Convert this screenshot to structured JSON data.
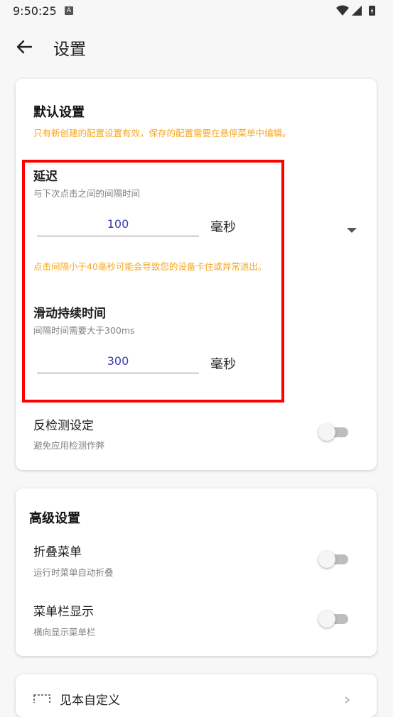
{
  "status_bar": {
    "time": "9:50:25",
    "notification_icon": "A"
  },
  "app_bar": {
    "title": "设置"
  },
  "default_settings": {
    "title": "默认设置",
    "notice": "只有新创建的配置设置有效，保存的配置需要在悬停菜单中编辑。",
    "delay": {
      "title": "延迟",
      "subtitle": "与下次点击之间的间隔时间",
      "value": "100",
      "unit": "毫秒",
      "warning": "点击间隔小于40毫秒可能会导致您的设备卡住或异常退出。"
    },
    "swipe_duration": {
      "title": "滑动持续时间",
      "subtitle": "间隔时间需要大于300ms",
      "value": "300",
      "unit": "毫秒"
    },
    "anti_detection": {
      "title": "反检测设定",
      "subtitle": "避免应用检测作弊",
      "enabled": false
    }
  },
  "advanced_settings": {
    "title": "高级设置",
    "collapse_menu": {
      "title": "折叠菜单",
      "subtitle": "运行时菜单自动折叠",
      "enabled": false
    },
    "menu_bar_display": {
      "title": "菜单栏显示",
      "subtitle": "横向显示菜单栏",
      "enabled": false
    }
  },
  "partial_card": {
    "title": "见本自定义"
  },
  "colors": {
    "accent_warning": "#f5a623",
    "input_text": "#3a3ab8",
    "highlight_border": "#ff0000"
  }
}
